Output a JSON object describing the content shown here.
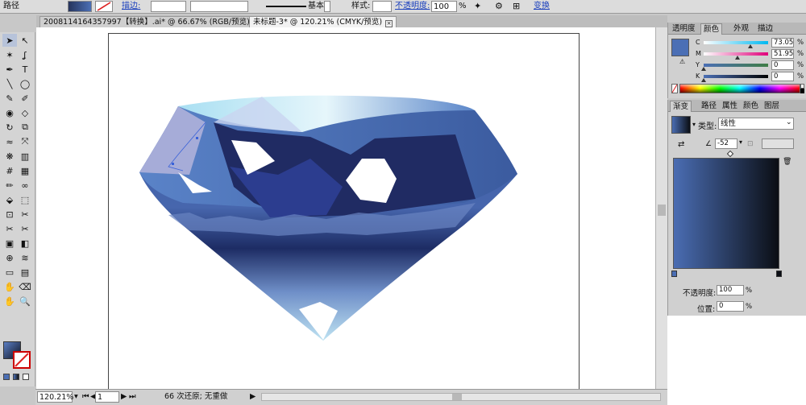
{
  "control_bar": {
    "object_type": "路径",
    "stroke_label": "描边:",
    "brush_label": "基本",
    "style_label": "样式:",
    "opacity_label": "不透明度:",
    "opacity_value": "100",
    "opacity_unit": "%",
    "transform_label": "变换"
  },
  "doc_tabs": [
    {
      "label": "2008114164357997【转换】.ai* @ 66.67% (RGB/预览)"
    },
    {
      "label": "未标题-3* @ 120.21% (CMYK/预览)"
    }
  ],
  "tools": [
    "selection-tool",
    "direct-selection-tool",
    "magic-wand-tool",
    "lasso-tool",
    "pen-tool",
    "type-tool",
    "line-segment-tool",
    "ellipse-tool",
    "paintbrush-tool",
    "pencil-tool",
    "blob-brush-tool",
    "eraser-tool",
    "rotate-tool",
    "scale-tool",
    "warp-tool",
    "free-transform-tool",
    "symbol-sprayer-tool",
    "column-graph-tool",
    "mesh-tool",
    "gradient-tool",
    "eyedropper-tool",
    "blend-tool",
    "live-paint-bucket-tool",
    "live-paint-selection-tool",
    "crop-tool",
    "slice-tool",
    "knife-tool",
    "scissors-tool",
    "perspective-grid-tool",
    "perspective-selection-tool",
    "shape-builder-tool",
    "width-tool",
    "artboard-tool",
    "graph-tool",
    "puppet-tool",
    "eraser2-tool",
    "hand-tool",
    "zoom-tool"
  ],
  "status_bar": {
    "zoom": "120.21%",
    "page": "1",
    "message": "66 次还原; 无重做"
  },
  "color_panel": {
    "tabs": [
      "透明度",
      "颜色",
      "外观",
      "描边"
    ],
    "active_tab": "颜色",
    "sliders": [
      {
        "label": "C",
        "value": "73.05",
        "marker": 0.7305
      },
      {
        "label": "M",
        "value": "51.95",
        "marker": 0.5195
      },
      {
        "label": "Y",
        "value": "0",
        "marker": 0.0
      },
      {
        "label": "K",
        "value": "0",
        "marker": 0.0
      }
    ],
    "fill_color": "#4b6fb5"
  },
  "gradient_panel": {
    "tabs": [
      "渐变",
      "路径",
      "属性",
      "颜色",
      "图层"
    ],
    "active_tab": "渐变",
    "type_label": "类型:",
    "type_value": "线性",
    "angle_value": "-52",
    "opacity_label": "不透明度:",
    "opacity_value": "100",
    "location_label": "位置:",
    "location_value": "0",
    "start_color": "#4a6db3",
    "end_color": "#0b0e14"
  }
}
